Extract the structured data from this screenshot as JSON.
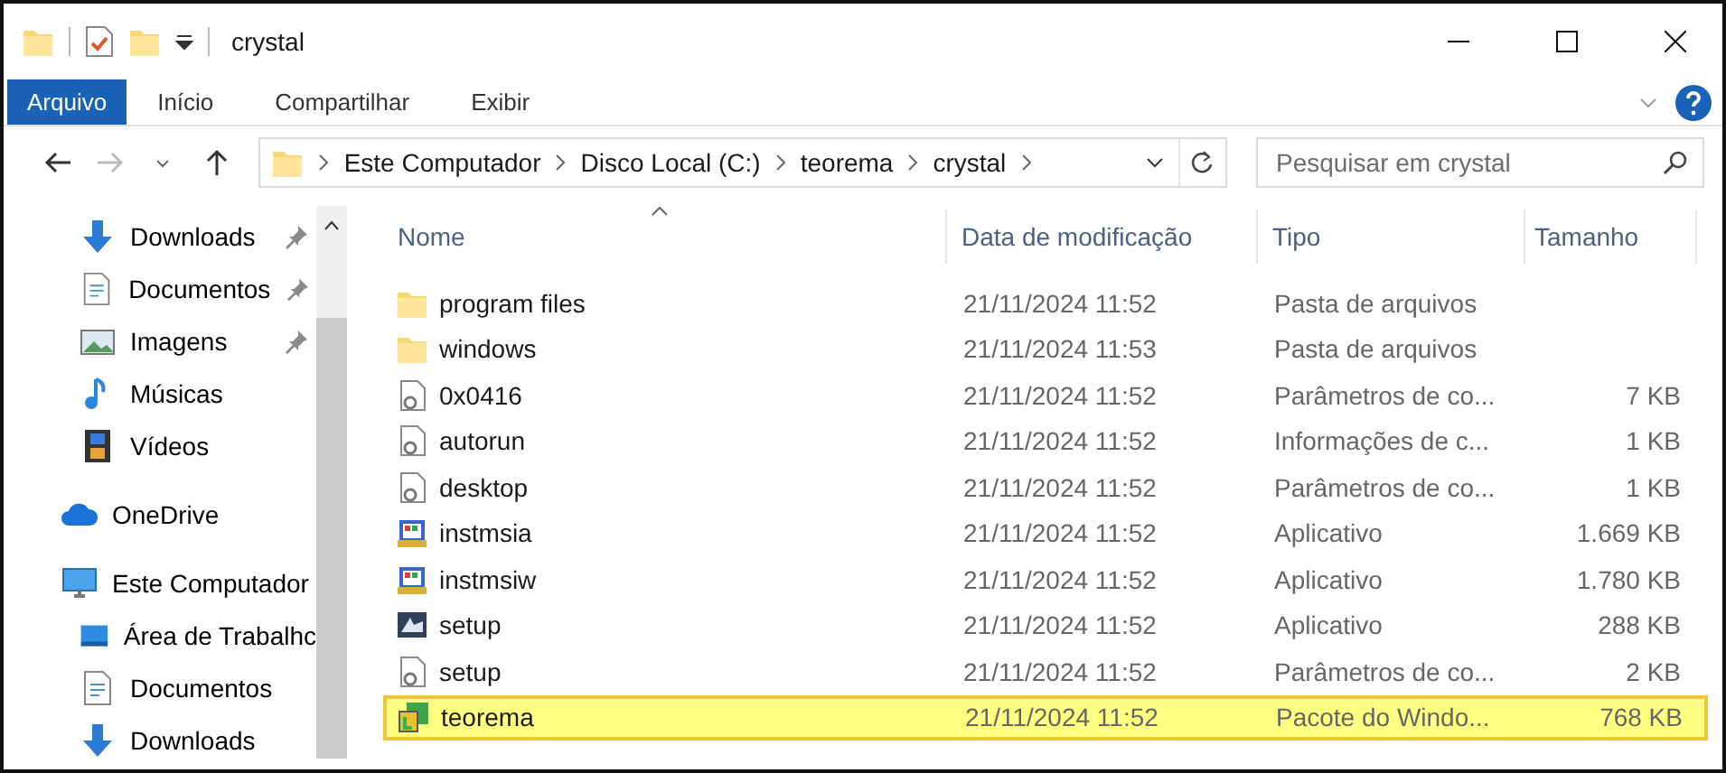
{
  "window": {
    "title": "crystal"
  },
  "ribbon_tabs": [
    {
      "label": "Arquivo",
      "kind": "file",
      "selected": false
    },
    {
      "label": "Início",
      "kind": "tab",
      "selected": false
    },
    {
      "label": "Compartilhar",
      "kind": "tab",
      "selected": false
    },
    {
      "label": "Exibir",
      "kind": "tab",
      "selected": false
    }
  ],
  "navigation": {
    "back_disabled": false,
    "forward_disabled": true
  },
  "address_bar": {
    "path": [
      "Este Computador",
      "Disco Local (C:)",
      "teorema",
      "crystal"
    ]
  },
  "search": {
    "placeholder": "Pesquisar em crystal"
  },
  "sidebar": {
    "quick_access": [
      {
        "label": "Downloads",
        "kind": "download",
        "pinned": true
      },
      {
        "label": "Documentos",
        "kind": "document",
        "pinned": true
      },
      {
        "label": "Imagens",
        "kind": "image",
        "pinned": true
      },
      {
        "label": "Músicas",
        "kind": "music",
        "pinned": false
      },
      {
        "label": "Vídeos",
        "kind": "video",
        "pinned": false
      }
    ],
    "items": [
      {
        "label": "OneDrive",
        "kind": "cloud"
      },
      {
        "label": "Este Computador",
        "kind": "computer",
        "children": [
          {
            "label": "Área de Trabalhc",
            "kind": "desktop"
          },
          {
            "label": "Documentos",
            "kind": "document"
          },
          {
            "label": "Downloads",
            "kind": "download"
          }
        ]
      }
    ]
  },
  "table": {
    "columns": [
      "Nome",
      "Data de modificação",
      "Tipo",
      "Tamanho"
    ],
    "rows": [
      {
        "kind": "folder",
        "name": "program files",
        "date": "21/11/2024 11:52",
        "type": "Pasta de arquivos",
        "selected": false
      },
      {
        "kind": "folder",
        "name": "windows",
        "date": "21/11/2024 11:53",
        "type": "Pasta de arquivos",
        "selected": false
      },
      {
        "kind": "config",
        "name": "0x0416",
        "date": "21/11/2024 11:52",
        "type": "Parâmetros de co...",
        "size": "7 KB",
        "selected": false
      },
      {
        "kind": "config",
        "name": "autorun",
        "date": "21/11/2024 11:52",
        "type": "Informações de c...",
        "size": "1 KB",
        "selected": false
      },
      {
        "kind": "config",
        "name": "desktop",
        "date": "21/11/2024 11:52",
        "type": "Parâmetros de co...",
        "size": "1 KB",
        "selected": false
      },
      {
        "kind": "installer",
        "name": "instmsia",
        "date": "21/11/2024 11:52",
        "type": "Aplicativo",
        "size": "1.669 KB",
        "selected": false
      },
      {
        "kind": "installer",
        "name": "instmsiw",
        "date": "21/11/2024 11:52",
        "type": "Aplicativo",
        "size": "1.780 KB",
        "selected": false
      },
      {
        "kind": "setup",
        "name": "setup",
        "date": "21/11/2024 11:52",
        "type": "Aplicativo",
        "size": "288 KB",
        "selected": false
      },
      {
        "kind": "config",
        "name": "setup",
        "date": "21/11/2024 11:52",
        "type": "Parâmetros de co...",
        "size": "2 KB",
        "selected": false
      },
      {
        "kind": "package",
        "name": "teorema",
        "date": "21/11/2024 11:52",
        "type": "Pacote do Windo...",
        "size": "768 KB",
        "selected": true
      }
    ]
  }
}
